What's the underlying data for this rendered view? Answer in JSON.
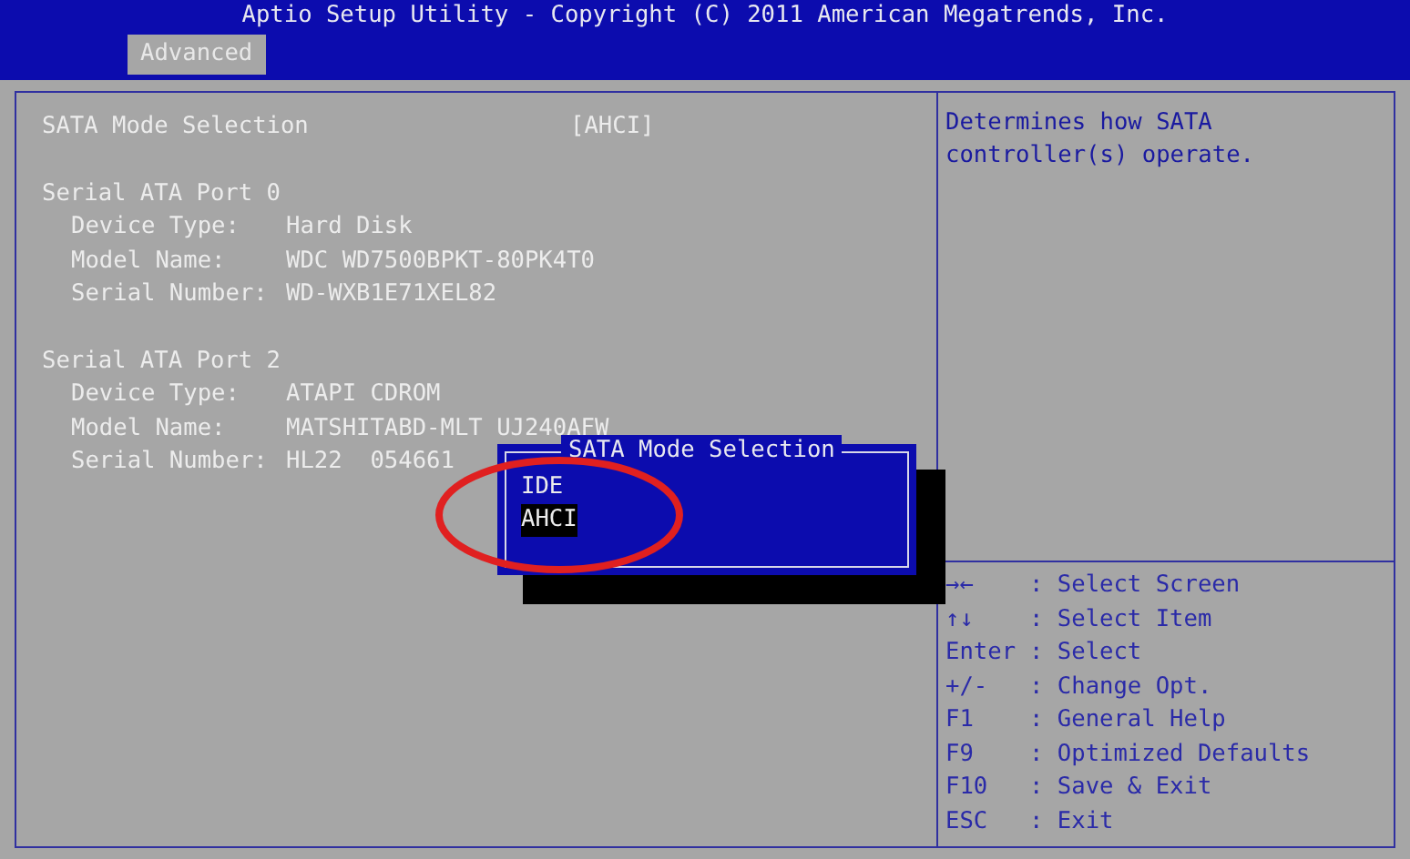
{
  "header": {
    "title": "Aptio Setup Utility - Copyright (C) 2011 American Megatrends, Inc."
  },
  "tabs": [
    {
      "label": "Advanced",
      "selected": true
    }
  ],
  "sata_mode": {
    "label": "SATA Mode Selection",
    "value": "[AHCI]"
  },
  "ports": [
    {
      "title": "Serial ATA Port 0",
      "fields": [
        {
          "label": "Device Type:",
          "value": "Hard Disk"
        },
        {
          "label": "Model Name:",
          "value": "WDC WD7500BPKT-80PK4T0"
        },
        {
          "label": "Serial Number:",
          "value": "WD-WXB1E71XEL82"
        }
      ]
    },
    {
      "title": "Serial ATA Port 2",
      "fields": [
        {
          "label": "Device Type:",
          "value": "ATAPI CDROM"
        },
        {
          "label": "Model Name:",
          "value": "MATSHITABD-MLT UJ240AFW"
        },
        {
          "label": "Serial Number:",
          "value": "HL22  054661"
        }
      ]
    }
  ],
  "popup": {
    "title": "SATA Mode Selection",
    "options": [
      {
        "label": "IDE",
        "selected": false
      },
      {
        "label": "AHCI",
        "selected": true
      }
    ]
  },
  "help": "Determines how SATA controller(s) operate.",
  "keys": [
    {
      "key": "→←",
      "action": ": Select Screen"
    },
    {
      "key": "↑↓",
      "action": ": Select Item"
    },
    {
      "key": "Enter",
      "action": ": Select"
    },
    {
      "key": "+/-",
      "action": ": Change Opt."
    },
    {
      "key": "F1",
      "action": ": General Help"
    },
    {
      "key": "F9",
      "action": ": Optimized Defaults"
    },
    {
      "key": "F10",
      "action": ": Save & Exit"
    },
    {
      "key": "ESC",
      "action": ": Exit"
    }
  ]
}
